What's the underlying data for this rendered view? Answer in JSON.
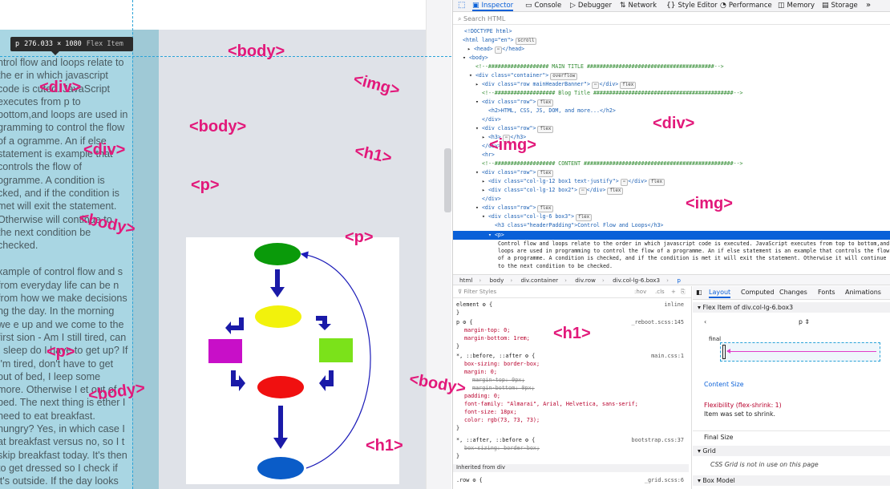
{
  "page": {
    "tooltip": {
      "tag": "p",
      "size": "276.033 × 1080",
      "kind": "Flex Item"
    },
    "paragraph1": "ntrol flow and loops relate to the er in which javascript code is cuted. JavaScript executes from p to bottom,and loops are used in gramming to control the flow of a ogramme. An if else statement is example that controls the flow of ogramme. A condition is cked, and if the condition is met will exit the statement. Otherwise will continue to the next condition be checked.",
    "paragraph2": "xample of control flow and s from everyday life can be n from how we make decisions ng the day. In the morning we e up and we come to the first sion - Am I still tired, can I sleep do I have to get up? If I'm tired, don't have to get out of bed, I leep some more. Otherwise I et out of bed. The next thing is ether I need to eat breakfast. hungry? Yes, in which case I at breakfast versus no, so I t skip breakfast today. It's then to get dressed so I check if it's outside. If the day looks",
    "overlays": [
      "<body>",
      "<div>",
      "<img>",
      "<body>",
      "<div>",
      "<h1>",
      "<p>",
      "<body>",
      "<p>",
      "<p>",
      "<body>",
      "<body>",
      "<h1>",
      "<div>",
      "<img>",
      "<img>",
      "<h1>"
    ]
  },
  "devtools": {
    "tabs": [
      "Inspector",
      "Console",
      "Debugger",
      "Network",
      "Style Editor",
      "Performance",
      "Memory",
      "Storage"
    ],
    "search_placeholder": "Search HTML",
    "markup": {
      "doctype": "<!DOCTYPE html>",
      "html_open": "<html lang=\"en\">",
      "head": "<head>",
      "head_close": "</head>",
      "body": "<body>",
      "c_main": "<!--################### MAIN TITLE ########################################-->",
      "container": "<div class=\"container\">",
      "banner": "<div class=\"row mainHeaderBanner\">",
      "banner_close": "</div>",
      "c_blog": "<!--################### Blog Title ############################################-->",
      "row1": "<div class=\"row\">",
      "h2": "<h2>HTML, CSS, JS, DOM, and more...</h2>",
      "div_close": "</div>",
      "row2": "<div class=\"row\">",
      "h3": "<h3>",
      "h3_close": "</h3>",
      "div_close2": "</div>",
      "hr": "<hr>",
      "c_content": "<!--################### CONTENT ###############################################-->",
      "row3": "<div class=\"row\">",
      "box1": "<div class=\"col-lg-12 box1 text-justify\">",
      "box1_close": "</div>",
      "box2": "<div class=\"col-lg-12 box2\">",
      "box2_close": "</div>",
      "div_close3": "</div>",
      "row4": "<div class=\"row\">",
      "box3": "<div class=\"col-lg-6 box3\">",
      "h3b": "<h3 class=\"headerPadding\">Control Flow and Loops</h3>",
      "p_sel": "<p>",
      "p_text": "Control flow and loops relate to the order in which javascript code is executed. JavaScript executes from top to bottom,and loops are used in programming to control the flow of a programme. An if else statement is an example that controls the flow of a programme. A condition is checked, and if the condition is met it will exit the statement. Otherwise it will continue to the next condition to be checked.",
      "badges": {
        "scroll": "scroll",
        "overflow": "overflow",
        "flex": "flex",
        "dots": "⋯"
      }
    },
    "breadcrumb": [
      "html",
      "body",
      "div.container",
      "div.row",
      "div.col-lg-6.box3",
      "p"
    ],
    "rules": {
      "filter_placeholder": "Filter Styles",
      "filter_buttons": [
        ":hov",
        ".cls",
        "+"
      ],
      "element": "element",
      "element_src": "inline",
      "p_sel": "p",
      "p_src": "_reboot.scss:145",
      "p_props": [
        "margin-top: 0;",
        "margin-bottom: 1rem;"
      ],
      "star_sel": "*, ::before, ::after",
      "star_src": "main.css:1",
      "star_props": [
        "box-sizing: border-box;",
        "margin: 0;",
        "margin-top: 0px;",
        "margin-bottom: 0px;",
        "padding: 0;",
        "font-family: \"Almarai\", Arial, Helvetica, sans-serif;",
        "font-size: 18px;",
        "color: rgb(73, 73, 73);"
      ],
      "star2_sel": "*, ::after, ::before",
      "star2_src": "bootstrap.css:37",
      "star2_prop": "box-sizing: border-box;",
      "inherited": "Inherited from div",
      "row_sel": ".row",
      "row_src": "_grid.scss:6",
      "brace_open": "{",
      "brace_close": "}"
    },
    "layout": {
      "tabs": [
        "Layout",
        "Computed",
        "Changes",
        "Fonts",
        "Animations"
      ],
      "flex_item_title": "Flex Item of div.col-lg-6.box3",
      "nav_selected": "p",
      "final_label": "final",
      "content_size": "Content Size",
      "flexibility": "Flexibility",
      "flexibility_detail": "(flex-shrink: 1)",
      "shrink_note": "Item was set to shrink.",
      "final_size": "Final Size",
      "grid": "Grid",
      "grid_note": "CSS Grid is not in use on this page",
      "box_model": "Box Model"
    },
    "colors": {
      "accent": "#0a60d8",
      "overlay": "#e2187a",
      "flex_bar": "#e23ec8"
    }
  }
}
